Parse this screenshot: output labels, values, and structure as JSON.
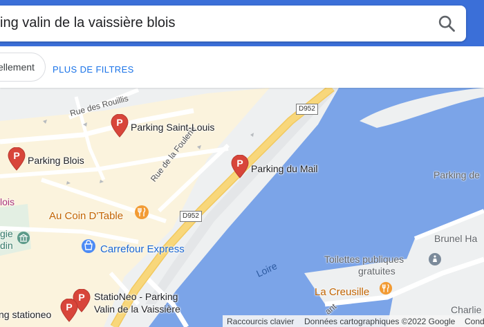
{
  "search": {
    "query": "ing valin de la vaissière blois"
  },
  "filters": {
    "chip_label": "ellement",
    "more_filters": "PLUS DE FILTRES"
  },
  "map": {
    "parkings": [
      {
        "name": "Parking Saint-Louis"
      },
      {
        "name": "Parking Blois"
      },
      {
        "name": "Parking du Mail"
      },
      {
        "name": "StatioNeo - Parking"
      },
      {
        "name": "Valin de la Vaissière"
      },
      {
        "name": "ng stationeo"
      }
    ],
    "places": {
      "au_coin": "Au Coin D'Table",
      "carrefour": "Carrefour Express",
      "parking_right": "Parking de",
      "toilettes_1": "Toilettes publiques",
      "toilettes_2": "gratuites",
      "creusille": "La Creusille",
      "brunel": "Brunel Ha",
      "charlie": "Charlie et",
      "blois": "lois",
      "gie": "gie",
      "din": "din"
    },
    "streets": {
      "rouillis": "Rue des Rouillis",
      "foulerie": "Rue de la Foulerie",
      "loire": "Loire",
      "ant": "ant"
    },
    "roads": {
      "d952_a": "D952",
      "d952_b": "D952"
    },
    "colors": {
      "water": "#7ba4e8",
      "major_road": "#f8d77b",
      "pin": "#d8453a",
      "accent": "#3b6fd8"
    }
  },
  "footer": {
    "shortcuts": "Raccourcis clavier",
    "data": "Données cartographiques ©2022 Google",
    "conditions": "Cond"
  }
}
